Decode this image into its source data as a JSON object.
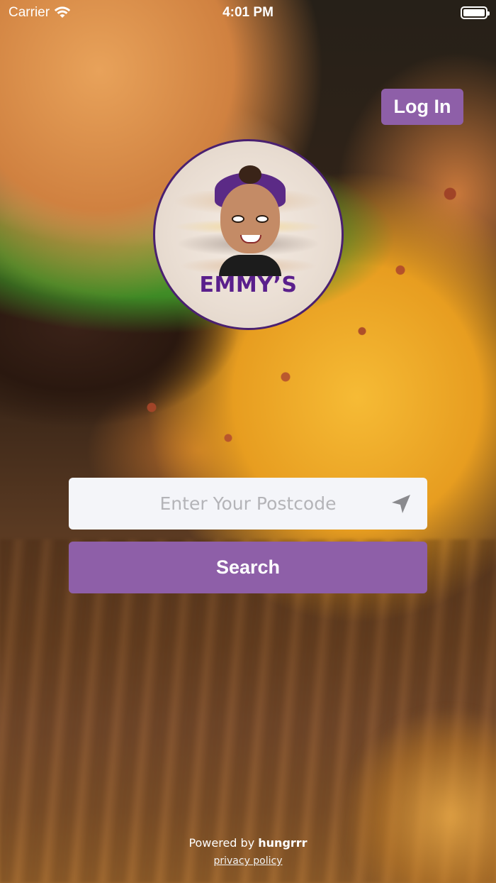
{
  "status_bar": {
    "carrier": "Carrier",
    "time": "4:01 PM"
  },
  "header": {
    "login_label": "Log In"
  },
  "logo": {
    "name": "EMMY’S"
  },
  "search": {
    "placeholder": "Enter Your Postcode",
    "value": "",
    "button_label": "Search",
    "location_icon": "location-arrow-icon"
  },
  "footer": {
    "powered_prefix": "Powered by",
    "powered_brand": "hungrrr",
    "privacy_label": "privacy policy"
  },
  "colors": {
    "accent": "#8e5fa8",
    "logo_text": "#5a1f8c",
    "input_bg": "#f4f5f9"
  }
}
